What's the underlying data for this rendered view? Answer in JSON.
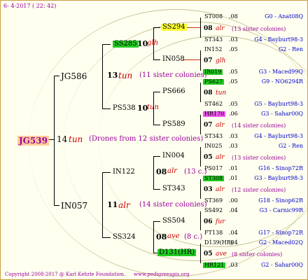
{
  "header": {
    "date": "6- 4-2017 ( 22: 42)"
  },
  "footer": {
    "copyright": "Copyright 2008-2017 @ Karl Kehrle Foundation.",
    "site": "www.pedigreeapis.org"
  },
  "colors": {
    "highlight_yellow": "#ffff33",
    "highlight_green": "#22cc22",
    "highlight_magenta": "#ee55ee",
    "link_blue": "#0000cc",
    "line_red": "#cc3300",
    "accent_purple": "#990099"
  },
  "pedigree": {
    "root": {
      "id": "JG539",
      "year": "14",
      "breeder": "tun",
      "note": "(Drones from 12 sister colonies)"
    },
    "dam": {
      "id": "JG586",
      "year": "13",
      "breeder": "tun",
      "note": "(11 sister colonies)"
    },
    "sire": {
      "id": "IN057",
      "year": "11",
      "breeder": "alr",
      "note": "(14 sister colonies)"
    },
    "dd": {
      "id": "SS285",
      "year": "10",
      "breeder": "glh"
    },
    "ds": {
      "id": "PS538",
      "year": "10",
      "breeder": "tun"
    },
    "sd": {
      "id": "IN122",
      "year": "08",
      "breeder": "alr",
      "note": "(13 c.)"
    },
    "ss": {
      "id": "SS324",
      "year": "08",
      "breeder": "ave",
      "note": "(8 c.)"
    },
    "g3": [
      {
        "id": "SS294"
      },
      {
        "id": "IN058"
      },
      {
        "id": "PS666"
      },
      {
        "id": "PS589"
      },
      {
        "id": "IN004"
      },
      {
        "id": "ST343"
      },
      {
        "id": "SS504"
      },
      {
        "id": "D131(HR)"
      }
    ],
    "g4": [
      {
        "id": "ST008",
        "year": ".08",
        "code": "G0 - Anat08Q"
      },
      {
        "year": "08",
        "breeder": "alr",
        "note": "(13 sister colonies)"
      },
      {
        "id": "ST343",
        "year": ".03",
        "code": "G4 - Bayburt98-3"
      },
      {
        "id": "IN152",
        "year": ".05",
        "code": "G2 - Ren"
      },
      {
        "year": "07",
        "breeder": "glh"
      },
      {
        "id": "IR019",
        "year": ".05",
        "code": "G3 - Maced99Q"
      },
      {
        "id": "PS627",
        "year": ".05",
        "code": "G9 - NO6294R"
      },
      {
        "year": "08",
        "breeder": "tun"
      },
      {
        "id": "ST462",
        "year": ".05",
        "code": "G5 - Bayburt98-3"
      },
      {
        "id": "HR170",
        "year": ".06",
        "code": "G3 - Sahar00Q"
      },
      {
        "year": "07",
        "breeder": "alr",
        "note": "(14 sister colonies)"
      },
      {
        "id": "ST343",
        "year": ".03",
        "code": "G4 - Bayburt98-3"
      },
      {
        "id": "IN025",
        "year": ".03",
        "code": "G2 - Ren"
      },
      {
        "year": "05",
        "breeder": "alr",
        "note": "(13 sister colonies)"
      },
      {
        "id": "PS017",
        "year": ".01",
        "code": "G16 - Sinop72R"
      },
      {
        "id": "ST308",
        "year": ".01",
        "code": "G3 - Bayburt98-3"
      },
      {
        "year": "03",
        "breeder": "alr",
        "note": "(12 sister colonies)"
      },
      {
        "id": "ST369",
        "year": ".00",
        "code": "G18 - Sinop62R"
      },
      {
        "id": "SS492",
        "year": ".04",
        "code": "G3 - Carnic99R"
      },
      {
        "year": "06",
        "breeder": "fur"
      },
      {
        "id": "FT138",
        "year": ".04",
        "code": "G17 - Sinop72R"
      },
      {
        "id": "D139(HR)",
        "year": ".04",
        "code": "G2 - Maced02Q"
      },
      {
        "year": "05",
        "breeder": "ave",
        "note": "(8 sister colonies)"
      },
      {
        "id": "HR121",
        "year": ".03",
        "code": "G2 - Sahar00Q"
      }
    ]
  }
}
